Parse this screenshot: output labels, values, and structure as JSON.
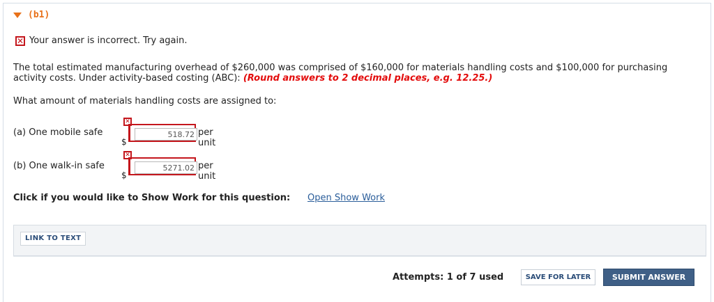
{
  "part": {
    "label": "(b1)"
  },
  "feedback": {
    "text": "Your answer is incorrect.  Try again."
  },
  "question": {
    "text": "The total estimated manufacturing overhead of $260,000 was comprised of $160,000 for materials handling costs and $100,000 for purchasing activity costs. Under activity-based costing (ABC): ",
    "round_note": "(Round answers to 2 decimal places, e.g. 12.25.)",
    "prompt": "What amount of materials handling costs are assigned to:"
  },
  "answers": [
    {
      "label": "(a)  One mobile safe",
      "currency": "$",
      "value": "518.72",
      "unit": "per unit",
      "status": "incorrect"
    },
    {
      "label": "(b)  One walk-in safe",
      "currency": "$",
      "value": "5271.02",
      "unit": "per unit",
      "status": "incorrect"
    }
  ],
  "show_work": {
    "prompt": "Click if you would like to Show Work for this question:",
    "link": "Open Show Work"
  },
  "link_to_text": {
    "label": "LINK TO TEXT"
  },
  "footer": {
    "attempts": "Attempts: 1 of 7 used",
    "save_label": "SAVE FOR LATER",
    "submit_label": "SUBMIT ANSWER"
  },
  "colors": {
    "accent": "#e8711a",
    "error": "#c4161c",
    "link": "#2a5d9a",
    "submit_bg": "#3f5f86"
  }
}
